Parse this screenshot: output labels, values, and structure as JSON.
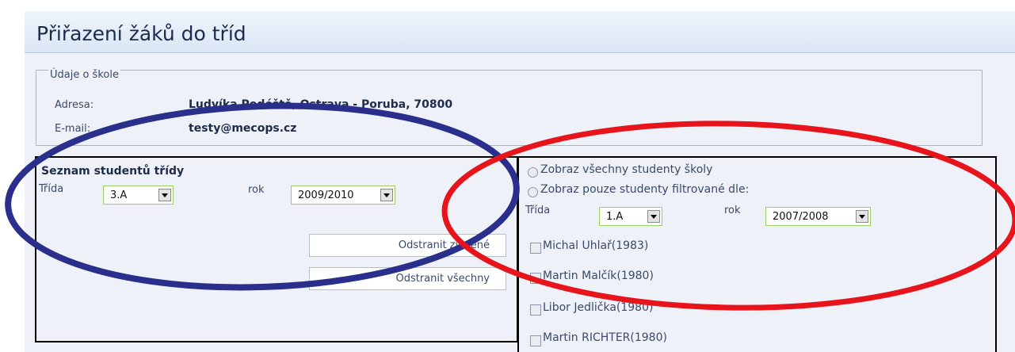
{
  "page": {
    "title": "Přiřazení žáků do tříd"
  },
  "school": {
    "legend": "Údaje o škole",
    "address_label": "Adresa:",
    "address_value": "Ludvíka Podéště, Ostrava - Poruba, 70800",
    "email_label": "E-mail:",
    "email_value": "testy@mecops.cz"
  },
  "left_panel": {
    "heading": "Seznam studentů třídy",
    "class_label": "Třída",
    "class_value": "3.A",
    "year_label": "rok",
    "year_value": "2009/2010",
    "remove_selected": "Odstranit zvolené",
    "remove_all": "Odstranit všechny"
  },
  "right_panel": {
    "radio_all": "Zobraz všechny studenty školy",
    "radio_filtered": "Zobraz pouze studenty filtrované dle:",
    "class_label": "Třída",
    "class_value": "1.A",
    "year_label": "rok",
    "year_value": "2007/2008",
    "students": [
      "Michal Uhlař(1983)",
      "Martin Malčík(1980)",
      "Libor Jedlička(1980)",
      "Martin RICHTER(1980)"
    ]
  },
  "annotations": {
    "left_ellipse_color": "#2b2f8c",
    "right_ellipse_color": "#e8141c"
  }
}
